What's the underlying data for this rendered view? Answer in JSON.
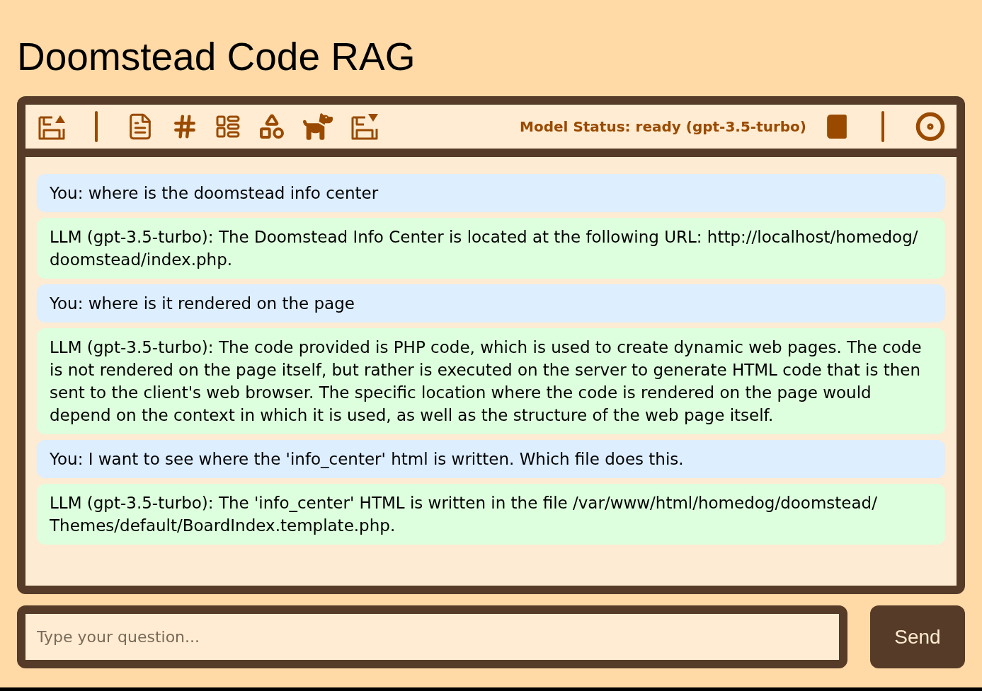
{
  "title": "Doomstead Code RAG",
  "toolbar": {
    "status": "Model Status: ready (gpt-3.5-turbo)"
  },
  "messages": [
    {
      "kind": "user",
      "text": "You: where is the doomstead info center"
    },
    {
      "kind": "llm",
      "text": "LLM (gpt-3.5-turbo): The Doomstead Info Center is located at the following URL: http://localhost/homedog/ doomstead/index.php."
    },
    {
      "kind": "user",
      "text": "You: where is it rendered on the page"
    },
    {
      "kind": "llm",
      "text": "LLM (gpt-3.5-turbo): The code provided is PHP code, which is used to create dynamic web pages. The code is not rendered on the page itself, but rather is executed on the server to generate HTML code that is then sent to the client's web browser. The specific location where the code is rendered on the page would depend on the context in which it is used, as well as the structure of the web page itself."
    },
    {
      "kind": "user",
      "text": "You: I want to see where the 'info_center' html is written. Which file does this."
    },
    {
      "kind": "llm",
      "text": "LLM (gpt-3.5-turbo): The 'info_center' HTML is written in the file /var/www/html/homedog/doomstead/ Themes/default/BoardIndex.template.php."
    }
  ],
  "input": {
    "placeholder": "Type your question..."
  },
  "send_button": "Send"
}
